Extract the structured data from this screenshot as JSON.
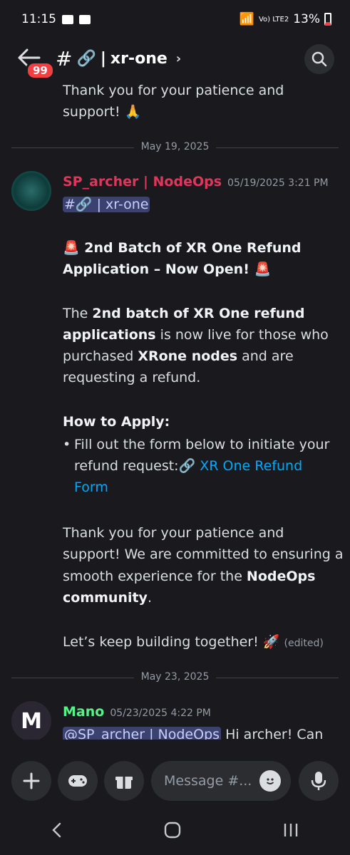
{
  "status_bar": {
    "time": "11:15",
    "battery": "13%",
    "network_label": "Vo) LTE2"
  },
  "header": {
    "badge_count": "99",
    "channel_icon": "#",
    "link_emoji": "🔗",
    "channel_name": "xr-one",
    "chevron": "›"
  },
  "messages_top": {
    "line1": "Thank you for your patience and",
    "line2": "support! 🙏"
  },
  "dividers": {
    "first": "May 19, 2025",
    "second": "May 23, 2025"
  },
  "message1": {
    "author": "SP_archer | NodeOps",
    "author_color": "#e0365b",
    "timestamp": "05/19/2025 3:21 PM",
    "channel_mention": "#🔗 | xr-one",
    "title_line1": "🚨 2nd Batch of XR One Refund",
    "title_line2": "Application – Now Open! 🚨",
    "p1_a": "The ",
    "p1_b": "2nd batch of XR One refund",
    "p1_c": "applications",
    "p1_d": " is now live for those who",
    "p1_e": "purchased ",
    "p1_f": "XRone nodes",
    "p1_g": " and are",
    "p1_h": "requesting a refund.",
    "howto": "How to Apply:",
    "bullet_line1": "Fill out the form below to initiate your",
    "bullet_line2a": "refund request:🔗 ",
    "bullet_link1": "XR One Refund",
    "bullet_link2": "Form",
    "p2_l1": "Thank you for your patience and",
    "p2_l2": "support! We are committed to ensuring a",
    "p2_l3a": "smooth experience for the ",
    "p2_l3b": "NodeOps",
    "p2_l4a": "community",
    "p2_l4b": ".",
    "closing": "Let’s keep building together! 🚀",
    "edited": "(edited)"
  },
  "message2": {
    "author": "Mano",
    "author_color": "#57f287",
    "timestamp": "05/23/2025 4:22 PM",
    "mention": "@SP_archer | NodeOps",
    "text": " Hi archer! Can"
  },
  "composer": {
    "placeholder": "Message #..."
  }
}
